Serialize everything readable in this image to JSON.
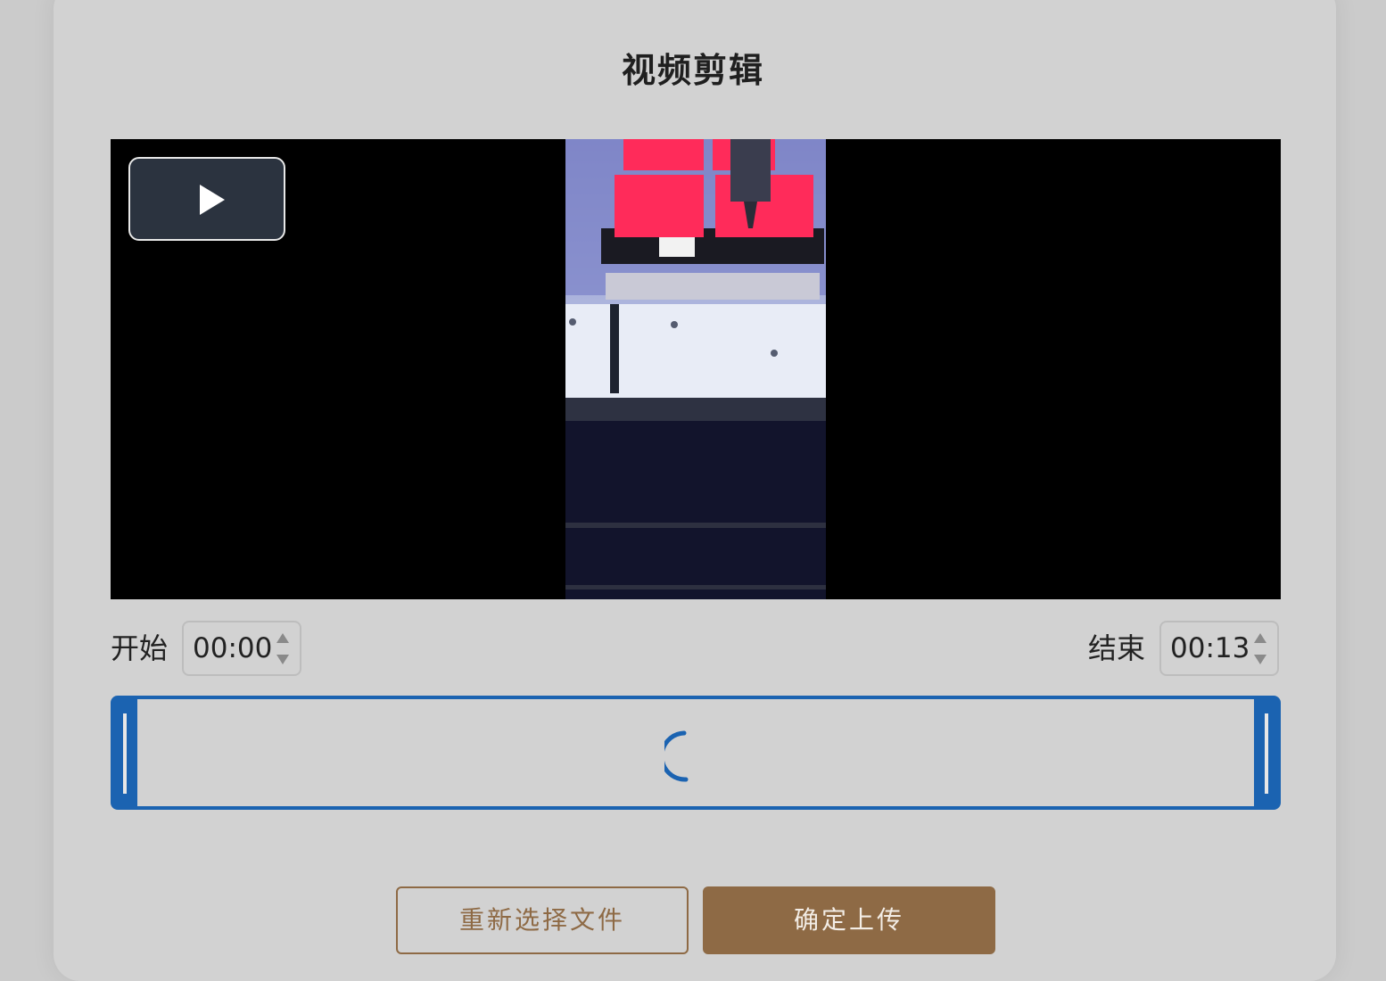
{
  "title": "视频剪辑",
  "player": {
    "play_icon": "play-icon",
    "frame_colors": {
      "tray": "#ff2b5a",
      "plate": "#f0f4fa",
      "glow": "#6e7cf0"
    }
  },
  "range": {
    "start_label": "开始",
    "start_value": "00:00",
    "end_label": "结束",
    "end_value": "00:13"
  },
  "timeline": {
    "loading_icon": "loading-spinner-icon"
  },
  "buttons": {
    "reselect": "重新选择文件",
    "confirm": "确定上传"
  },
  "colors": {
    "accent": "#8e6a45",
    "selection": "#1b63b1"
  }
}
